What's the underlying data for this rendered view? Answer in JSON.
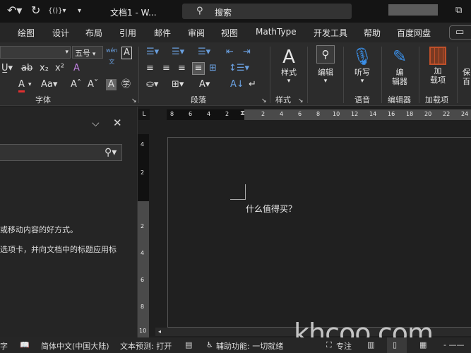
{
  "title_bar": {
    "doc_title": "文档1 - W...",
    "search_placeholder": "搜索",
    "undo_icon": "undo-icon",
    "redo_icon": "redo-icon"
  },
  "tabs": [
    "绘图",
    "设计",
    "布局",
    "引用",
    "邮件",
    "审阅",
    "视图",
    "MathType",
    "开发工具",
    "帮助",
    "百度网盘"
  ],
  "ribbon": {
    "font_size": "五号",
    "groups": {
      "font": "字体",
      "paragraph": "段落",
      "styles": "样式",
      "voice": "语音",
      "editor": "编辑器",
      "addins": "加载项"
    },
    "buttons": {
      "styles": "样式",
      "editing": "编辑",
      "dictate": "听写",
      "editor_line1": "编",
      "editor_line2": "辑器",
      "addins_line1": "加",
      "addins_line2": "载项",
      "baidu_line1": "保",
      "baidu_line2": "百"
    },
    "font_color": "#e03030"
  },
  "ruler": {
    "left": [
      "8",
      "6",
      "4",
      "2"
    ],
    "right": [
      "2",
      "4",
      "6",
      "8",
      "10",
      "12",
      "14",
      "16",
      "18",
      "20",
      "22",
      "24"
    ],
    "vertical": [
      "4",
      "2",
      "",
      "2",
      "4",
      "6",
      "8",
      "10"
    ]
  },
  "nav_pane": {
    "text1": "或移动内容的好方式。",
    "text2": "选项卡，并向文档中的标题应用标"
  },
  "document": {
    "text": "什么值得买？"
  },
  "status_bar": {
    "words": "字",
    "language": "简体中文(中国大陆)",
    "prediction": "文本预测: 打开",
    "accessibility": "辅助功能: 一切就绪",
    "focus": "专注"
  },
  "watermark": "khcoo.com"
}
